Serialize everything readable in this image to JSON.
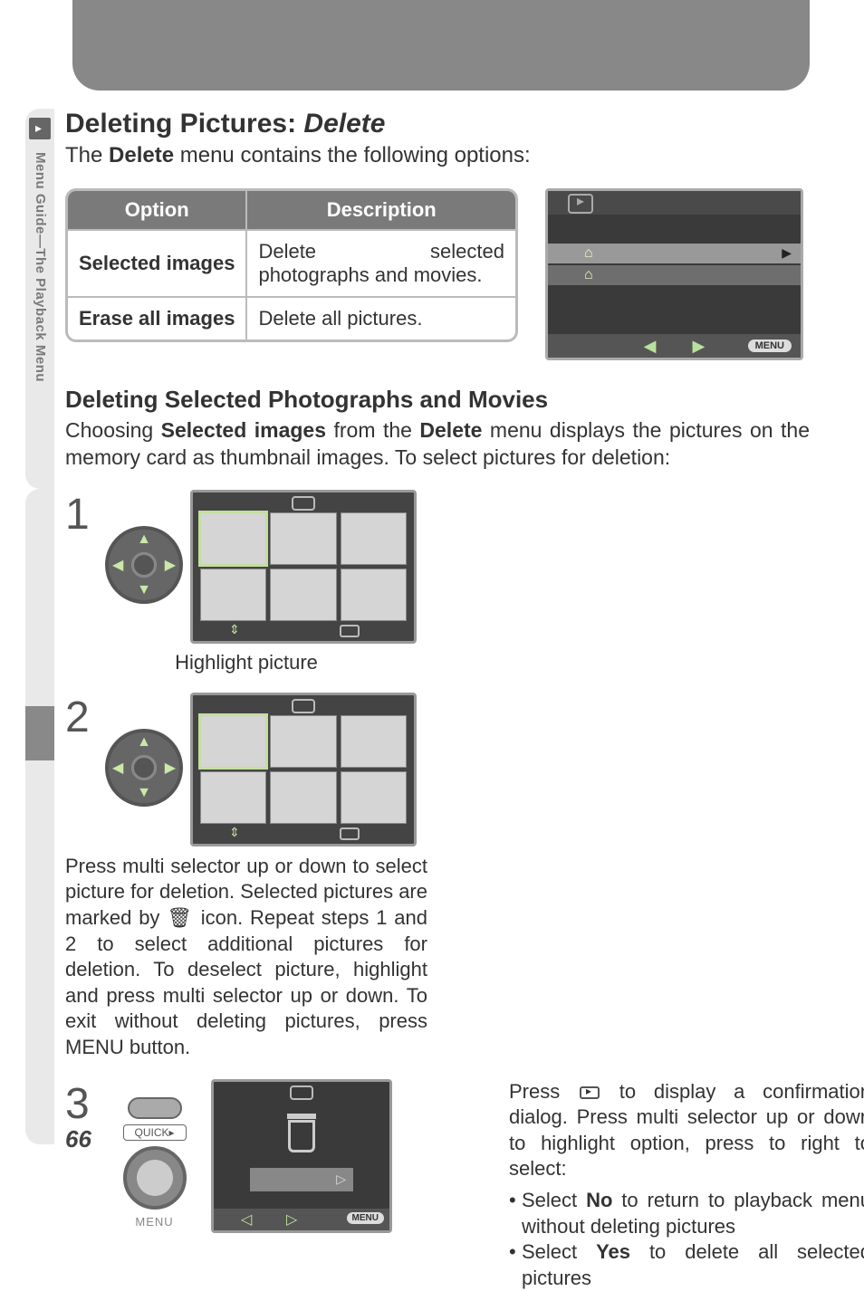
{
  "sideTab": "Menu Guide—The Playback Menu",
  "title": {
    "pre": "Deleting Pictures: ",
    "em": "Delete"
  },
  "intro": {
    "a": "The ",
    "b": "Delete",
    "c": " menu contains the following options:"
  },
  "table": {
    "headers": {
      "opt": "Option",
      "desc": "Description"
    },
    "rows": [
      {
        "opt": "Selected images",
        "desc": "Delete selected photographs and movies."
      },
      {
        "opt": "Erase all images",
        "desc": "Delete all pictures."
      }
    ]
  },
  "menuScreen": {
    "bottomLabel": "MENU"
  },
  "sub": "Deleting Selected Photographs and Movies",
  "para": {
    "a": "Choosing ",
    "b": "Selected images",
    "c": " from the ",
    "d": "Delete",
    "e": " menu displays the pictures on the memory card as thumbnail images.  To select pictures for deletion:"
  },
  "steps": {
    "s1": {
      "num": "1",
      "cap": "Highlight picture"
    },
    "s2": {
      "num": "2",
      "text": "Press multi selector up or down to select picture for deletion.  Selected pictures are marked by 🗑 icon.  Repeat steps 1 and 2 to select additional pictures for deletion.  To deselect picture, highlight and press multi selector up or down.  To exit without deleting pictures, press MENU button."
    },
    "s3": {
      "num": "3",
      "quick": "QUICK▸",
      "menu": "MENU",
      "confirmMenu": "MENU",
      "textA": "Press ",
      "textB": " to display a confirmation dialog.  Press multi selector up or down to highlight option, press to right to select:",
      "bullets": {
        "b1a": "Select ",
        "b1b": "No",
        "b1c": " to return to playback menu without deleting pictures",
        "b2a": "Select ",
        "b2b": "Yes",
        "b2c": " to delete all selected pictures"
      }
    }
  },
  "pageNum": "66"
}
